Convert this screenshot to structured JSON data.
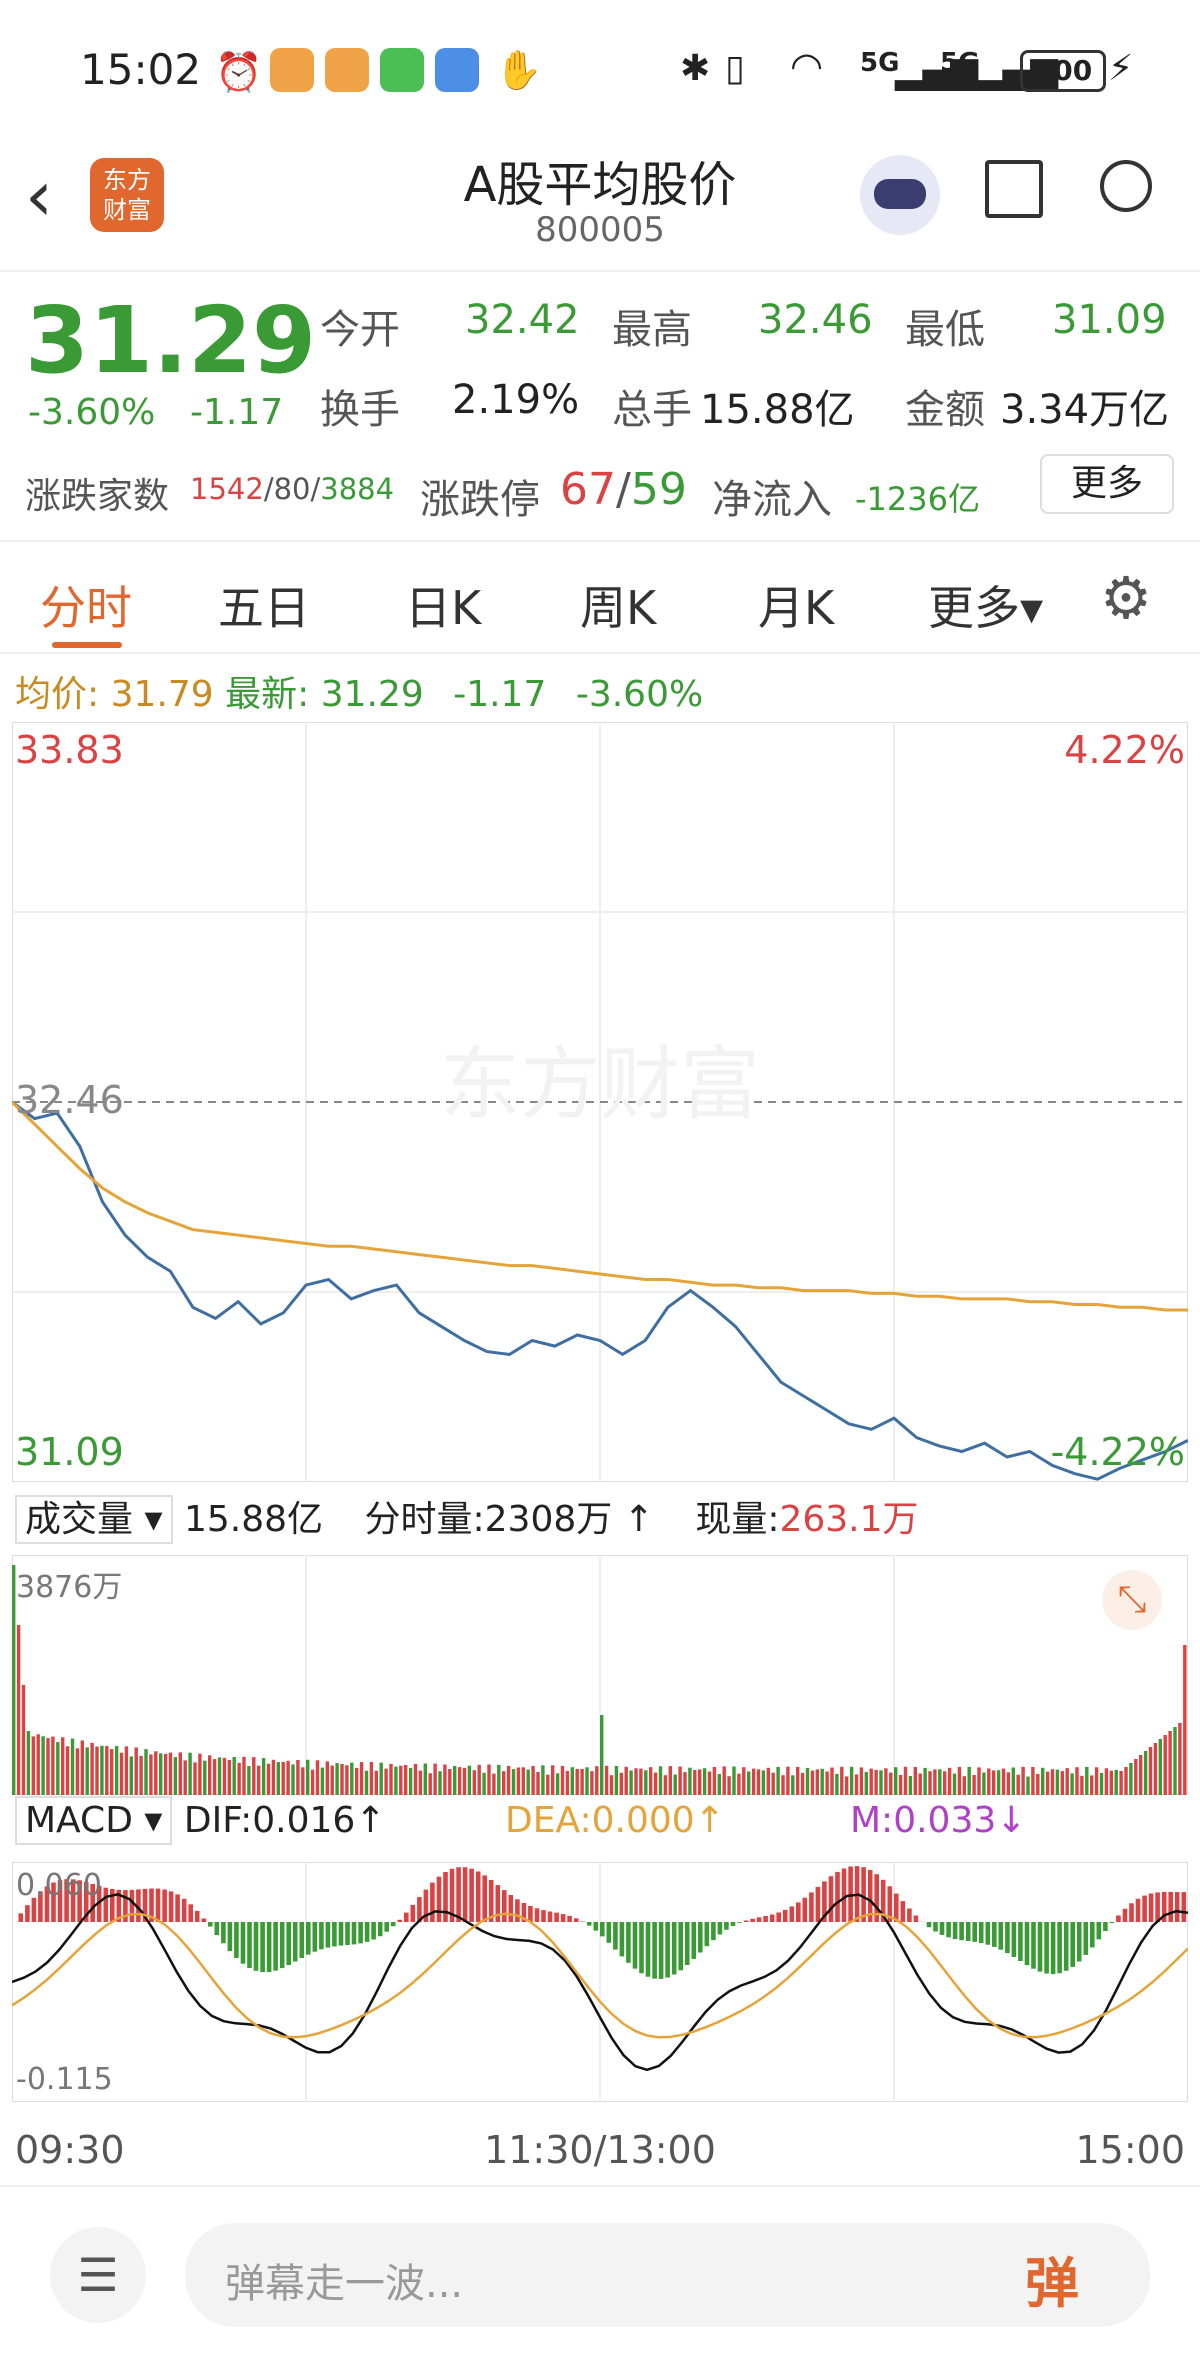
{
  "status": {
    "time": "15:02",
    "signal_labels": [
      "5G",
      "5G"
    ],
    "battery": "100"
  },
  "header": {
    "title": "A股平均股价",
    "code": "800005",
    "logo_text": "东方财富"
  },
  "quote": {
    "price": "31.29",
    "change_pct": "-3.60%",
    "change": "-1.17",
    "open_label": "今开",
    "open": "32.42",
    "high_label": "最高",
    "high": "32.46",
    "low_label": "最低",
    "low": "31.09",
    "turnover_label": "换手",
    "turnover": "2.19%",
    "volume_label": "总手",
    "volume": "15.88亿",
    "amount_label": "金额",
    "amount": "3.34万亿",
    "breadth_label": "涨跌家数",
    "up": "1542",
    "flat": "80",
    "down": "3884",
    "limit_label": "涨跌停",
    "limit_up": "67",
    "limit_down": "59",
    "netflow_label": "净流入",
    "netflow": "-1236亿",
    "more_button": "更多"
  },
  "tabs": [
    "分时",
    "五日",
    "日K",
    "周K",
    "月K",
    "更多▾"
  ],
  "chart": {
    "avg_label": "均价:",
    "avg_value": "31.79",
    "latest_label": "最新:",
    "latest_value": "31.29",
    "latest_change": "-1.17",
    "latest_pct": "-3.60%",
    "price_top": "33.83",
    "price_ref": "32.46",
    "price_bottom": "31.09",
    "pct_top": "4.22%",
    "pct_bottom": "-4.22%",
    "watermark": "东方财富",
    "vol_label": "成交量",
    "vol_total": "15.88亿",
    "vol_tick_label": "分时量:",
    "vol_tick": "2308万",
    "vol_now_label": "现量:",
    "vol_now": "263.1万",
    "vol_max": "3876万",
    "macd_label": "MACD",
    "dif": "DIF:0.016",
    "dea": "DEA:0.000",
    "m": "M:0.033",
    "macd_top": "0.060",
    "macd_bottom": "-0.115",
    "time_start": "09:30",
    "time_mid": "11:30/13:00",
    "time_end": "15:00"
  },
  "bottom": {
    "placeholder": "弹幕走一波...",
    "danmu_button": "弹"
  },
  "colors": {
    "up": "#d94343",
    "down": "#3a9a35",
    "avg_line": "#e5a43a",
    "price_line": "#3f6fa0",
    "accent": "#e0672e"
  },
  "chart_data": {
    "type": "line",
    "x_labels": [
      "09:30",
      "11:30/13:00",
      "15:00"
    ],
    "ylim": [
      31.09,
      33.83
    ],
    "reference": 32.46,
    "series": [
      {
        "name": "",
        "values": [
          32.46,
          32.4,
          32.42,
          32.3,
          32.1,
          31.98,
          31.9,
          31.85,
          31.72,
          31.68,
          31.74,
          31.66,
          31.7,
          31.8,
          31.82,
          31.75,
          31.78,
          31.8,
          31.7,
          31.65,
          31.6,
          31.56,
          31.55,
          31.6,
          31.58,
          31.62,
          31.6,
          31.55,
          31.6,
          31.72,
          31.78,
          31.72,
          31.65,
          31.55,
          31.45,
          31.4,
          31.35,
          31.3,
          31.28,
          31.32,
          31.25,
          31.22,
          31.2,
          31.23,
          31.18,
          31.2,
          31.15,
          31.12,
          31.1,
          31.14,
          31.17,
          31.2,
          31.24
        ]
      },
      {
        "name": "",
        "values": [
          32.46,
          32.38,
          32.3,
          32.22,
          32.15,
          32.1,
          32.06,
          32.03,
          32.0,
          31.99,
          31.98,
          31.97,
          31.96,
          31.95,
          31.94,
          31.94,
          31.93,
          31.92,
          31.91,
          31.9,
          31.89,
          31.88,
          31.87,
          31.87,
          31.86,
          31.85,
          31.84,
          31.83,
          31.82,
          31.82,
          31.81,
          31.8,
          31.8,
          31.79,
          31.79,
          31.78,
          31.78,
          31.78,
          31.77,
          31.77,
          31.76,
          31.76,
          31.75,
          31.75,
          31.75,
          31.74,
          31.74,
          31.73,
          31.73,
          31.72,
          31.72,
          31.71,
          31.71
        ]
      }
    ]
  }
}
